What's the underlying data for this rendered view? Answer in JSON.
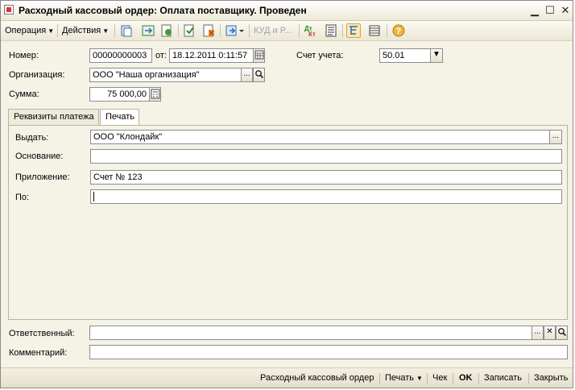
{
  "window": {
    "title": "Расходный кассовый ордер: Оплата поставщику. Проведен",
    "controls": [
      "minimize-icon",
      "maximize-icon",
      "close-icon"
    ]
  },
  "toolbar": {
    "operation_label": "Операция",
    "actions_label": "Действия",
    "kud_label": "КУД и Р...",
    "icons": [
      "copy-document-icon",
      "refresh-icon",
      "reload-icon",
      "post-icon",
      "unpost-icon",
      "related-docs-icon",
      "dt-kt-icon",
      "report-icon",
      "structure-icon",
      "list-icon",
      "help-icon"
    ]
  },
  "form": {
    "number_label": "Номер:",
    "number_value": "00000000003",
    "date_label": "от:",
    "date_value": "18.12.2011  0:11:57",
    "account_label": "Счет учета:",
    "account_value": "50.01",
    "org_label": "Организация:",
    "org_value": "ООО \"Наша организация\"",
    "sum_label": "Сумма:",
    "sum_value": "75 000,00"
  },
  "tabs": [
    {
      "label": "Реквизиты платежа",
      "active": false
    },
    {
      "label": "Печать",
      "active": true
    }
  ],
  "print_tab": {
    "issue_label": "Выдать:",
    "issue_value": "ООО \"Клондайк\"",
    "basis_label": "Основание:",
    "basis_value": "",
    "attachment_label": "Приложение:",
    "attachment_value": "Счет № 123",
    "by_label": "По:",
    "by_value": ""
  },
  "footer": {
    "responsible_label": "Ответственный:",
    "responsible_value": "",
    "comment_label": "Комментарий:",
    "comment_value": ""
  },
  "bottom_bar": {
    "rko_label": "Расходный кассовый ордер",
    "print_label": "Печать",
    "check_label": "Чек",
    "ok_label": "OK",
    "save_label": "Записать",
    "close_label": "Закрыть"
  }
}
